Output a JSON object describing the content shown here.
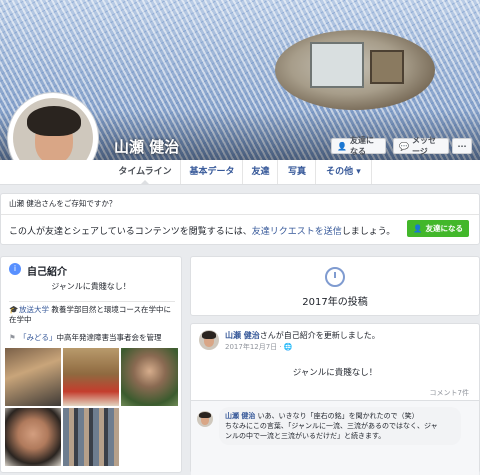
{
  "profile": {
    "name": "山瀬 健治"
  },
  "cover_buttons": {
    "add_friend": "友達になる",
    "message": "メッセージ",
    "more": "···"
  },
  "tabs": [
    "タイムライン",
    "基本データ",
    "友達",
    "写真",
    "その他 ▾"
  ],
  "know_panel": {
    "question": "山瀬 健治さんをご存知ですか？",
    "body_prefix": "この人が友達とシェアしているコンテンツを閲覧するには、",
    "body_link": "友達リクエストを送信",
    "body_suffix": "しましょう。",
    "button": "友達になる"
  },
  "intro": {
    "title": "自己紹介",
    "bio": "ジャンルに貴賤なし！",
    "education_link": "放送大学",
    "education_text": " 教養学部目然と環境コース在学中に在学中",
    "page_link": "「みどる」",
    "page_text": "中高年発達障害当事者会を管理"
  },
  "timeline": {
    "year_heading": "2017年の投稿",
    "post": {
      "author": "山瀬 健治",
      "action": "さんが自己紹介を更新しました。",
      "date": "2017年12月7日 · 🌐",
      "body": "ジャンルに貴賤なし！",
      "comments": "コメント7件"
    },
    "comment": {
      "author": "山瀬 健治",
      "line1": " いあ、いきなり「座右の銘」を聞かれたので（笑）",
      "line2": "ちなみにこの言葉、「ジャンルに一流、三流があるのではなく、ジャ",
      "line3": "ンルの中で一流と三流がいるだけだ」と続きます。"
    }
  },
  "colors": {
    "link": "#365899",
    "green": "#42b72a",
    "bg": "#e9ebee"
  },
  "icons": [
    "add-friend-icon",
    "messenger-icon",
    "clock-icon",
    "info-icon",
    "school-icon",
    "flag-icon",
    "globe-icon"
  ]
}
